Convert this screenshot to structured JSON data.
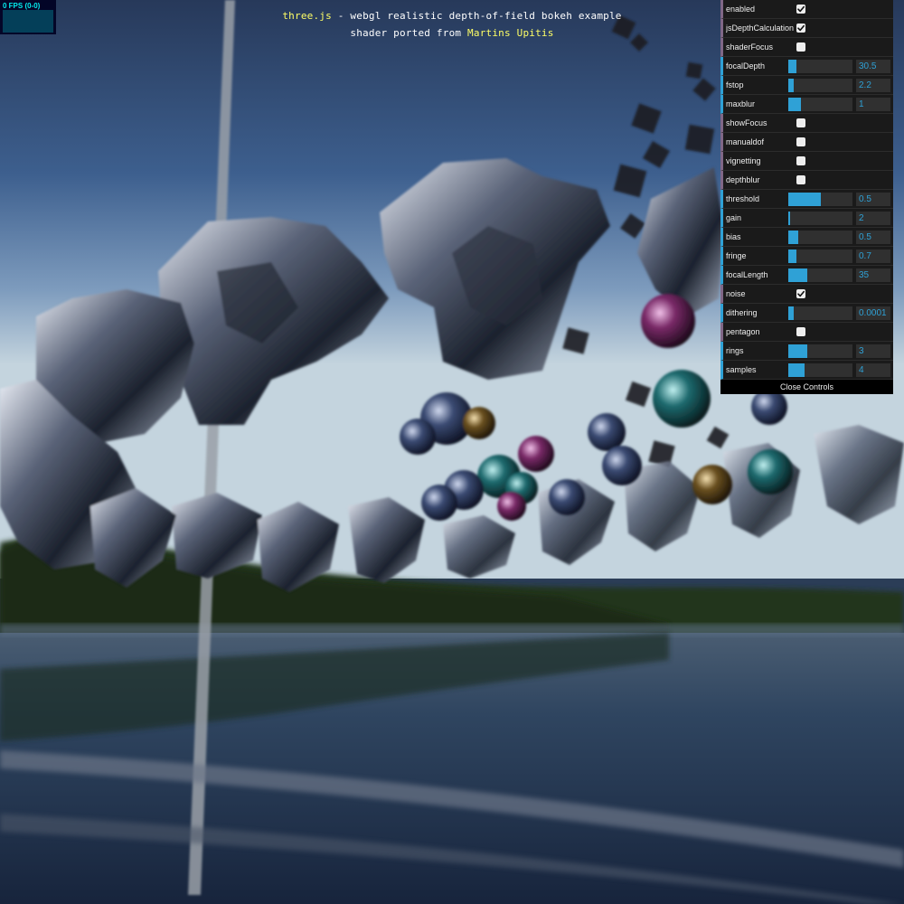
{
  "info": {
    "link_threejs": "three.js",
    "line1_rest": " - webgl realistic depth-of-field bokeh example",
    "line2_prefix": "shader ported from ",
    "link_author": "Martins Upitis"
  },
  "stats": {
    "fps_text": "0 FPS (0-0)"
  },
  "controls": [
    {
      "label": "enabled",
      "type": "bool",
      "checked": true
    },
    {
      "label": "jsDepthCalculation",
      "type": "bool",
      "checked": true
    },
    {
      "label": "shaderFocus",
      "type": "bool",
      "checked": false
    },
    {
      "label": "focalDepth",
      "type": "num",
      "value": "30.5",
      "level": 0.13
    },
    {
      "label": "fstop",
      "type": "num",
      "value": "2.2",
      "level": 0.08
    },
    {
      "label": "maxblur",
      "type": "num",
      "value": "1",
      "level": 0.2
    },
    {
      "label": "showFocus",
      "type": "bool",
      "checked": false
    },
    {
      "label": "manualdof",
      "type": "bool",
      "checked": false
    },
    {
      "label": "vignetting",
      "type": "bool",
      "checked": false
    },
    {
      "label": "depthblur",
      "type": "bool",
      "checked": false
    },
    {
      "label": "threshold",
      "type": "num",
      "value": "0.5",
      "level": 0.5
    },
    {
      "label": "gain",
      "type": "num",
      "value": "2",
      "level": 0.02
    },
    {
      "label": "bias",
      "type": "num",
      "value": "0.5",
      "level": 0.16
    },
    {
      "label": "fringe",
      "type": "num",
      "value": "0.7",
      "level": 0.13
    },
    {
      "label": "focalLength",
      "type": "num",
      "value": "35",
      "level": 0.3
    },
    {
      "label": "noise",
      "type": "bool",
      "checked": true
    },
    {
      "label": "dithering",
      "type": "num",
      "value": "0.0001",
      "level": 0.08
    },
    {
      "label": "pentagon",
      "type": "bool",
      "checked": false
    },
    {
      "label": "rings",
      "type": "num",
      "value": "3",
      "level": 0.29
    },
    {
      "label": "samples",
      "type": "num",
      "value": "4",
      "level": 0.25
    }
  ],
  "close_label": "Close Controls",
  "colors": {
    "accent_number": "#2fa1d6",
    "accent_boolean": "#806787",
    "info_highlight": "#ffff66"
  }
}
